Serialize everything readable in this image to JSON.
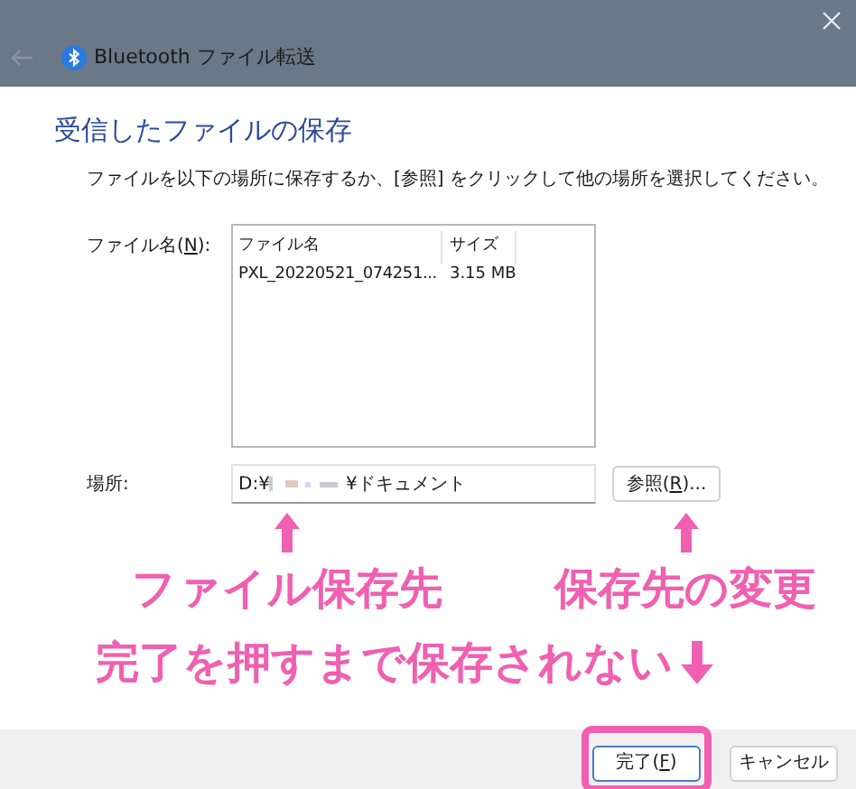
{
  "window": {
    "title": "Bluetooth ファイル転送"
  },
  "heading": "受信したファイルの保存",
  "instruction": "ファイルを以下の場所に保存するか、[参照] をクリックして他の場所を選択してください。",
  "file_label": {
    "parts": [
      "ファイル名(",
      "N",
      "):"
    ]
  },
  "file_list": {
    "columns": [
      "ファイル名",
      "サイズ"
    ],
    "rows": [
      {
        "name": "PXL_20220521_074251...",
        "size": "3.15 MB"
      }
    ]
  },
  "location_label": "場所:",
  "location": {
    "value_start": "D:¥",
    "value_end": "¥ドキュメント"
  },
  "browse_button": {
    "parts": [
      "参照(",
      "R",
      ")..."
    ]
  },
  "annotations": [
    {
      "kind": "up",
      "text": "ファイル保存先"
    },
    {
      "kind": "up",
      "text": "保存先の変更"
    },
    {
      "kind": "down",
      "text": "完了を押すまで保存されない"
    }
  ],
  "footer_buttons": [
    {
      "parts": [
        "完了(",
        "F",
        ")"
      ],
      "highlighted": true
    },
    {
      "parts": [
        "キャンセル"
      ],
      "highlighted": false
    }
  ]
}
